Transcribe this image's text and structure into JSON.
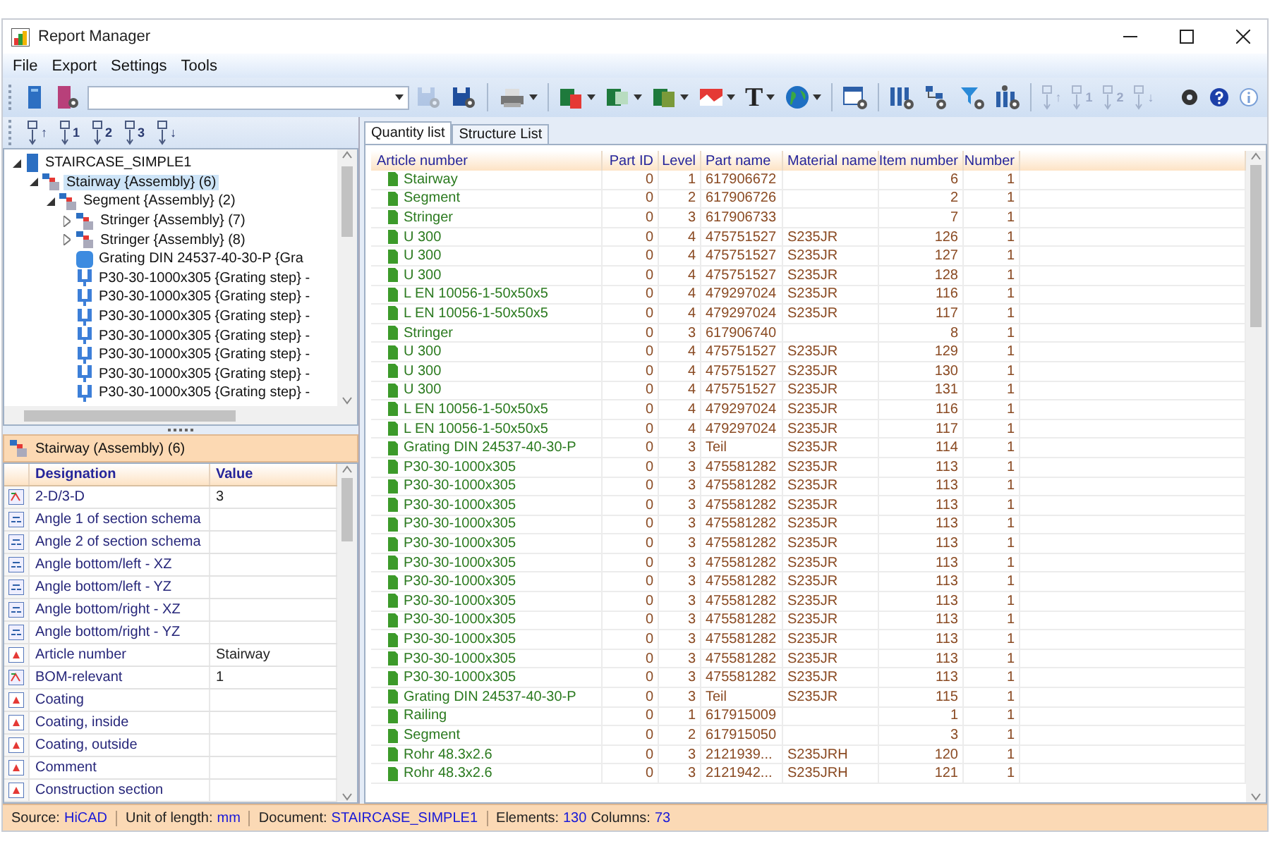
{
  "window": {
    "title": "Report Manager"
  },
  "menu": [
    "File",
    "Export",
    "Settings",
    "Tools"
  ],
  "toolbar": {
    "items": [
      {
        "kind": "book"
      },
      {
        "kind": "book-gear"
      },
      {
        "kind": "combo"
      },
      {
        "kind": "save",
        "disabled": true
      },
      {
        "kind": "save-gear",
        "disabled": false
      },
      {
        "kind": "separator"
      },
      {
        "kind": "printer",
        "dropdown": true
      },
      {
        "kind": "separator"
      },
      {
        "kind": "excel-pdf",
        "dropdown": true
      },
      {
        "kind": "excel",
        "dropdown": true
      },
      {
        "kind": "excel-doc",
        "dropdown": true
      },
      {
        "kind": "image",
        "dropdown": true
      },
      {
        "kind": "glyph",
        "glyph": "T",
        "dropdown": true
      },
      {
        "kind": "globe",
        "dropdown": true
      },
      {
        "kind": "separator"
      },
      {
        "kind": "table-gear"
      },
      {
        "kind": "separator"
      },
      {
        "kind": "columns-gear"
      },
      {
        "kind": "tree-gear"
      },
      {
        "kind": "filter-gear"
      },
      {
        "kind": "person-columns"
      },
      {
        "kind": "separator"
      },
      {
        "kind": "sort",
        "mark": "↑",
        "disabled": true
      },
      {
        "kind": "sort",
        "mark": "1",
        "disabled": true
      },
      {
        "kind": "sort",
        "mark": "2",
        "disabled": true
      },
      {
        "kind": "sort",
        "mark": "↓",
        "disabled": true
      },
      {
        "kind": "spacer"
      },
      {
        "kind": "gear"
      },
      {
        "kind": "help"
      },
      {
        "kind": "info"
      }
    ]
  },
  "sort_toolbar": [
    {
      "mark": "↑"
    },
    {
      "mark": "1"
    },
    {
      "mark": "2"
    },
    {
      "mark": "3"
    },
    {
      "mark": "↓"
    }
  ],
  "tree": [
    {
      "label": "STAIRCASE_SIMPLE1",
      "kind": "document",
      "expanded": true,
      "selected": false,
      "children": [
        {
          "label": "Stairway {Assembly} (6)",
          "kind": "assembly",
          "expanded": true,
          "selected": true,
          "children": [
            {
              "label": "Segment {Assembly} (2)",
              "kind": "assembly",
              "expanded": true,
              "selected": false,
              "children": [
                {
                  "label": "Stringer {Assembly} (7)",
                  "kind": "assembly",
                  "expanded": false,
                  "selected": false
                },
                {
                  "label": "Stringer {Assembly} (8)",
                  "kind": "assembly",
                  "expanded": false,
                  "selected": false
                },
                {
                  "label": "Grating DIN 24537-40-30-P {Gra",
                  "kind": "grating",
                  "selected": false
                },
                {
                  "label": "P30-30-1000x305 {Grating step} -",
                  "kind": "step",
                  "selected": false
                },
                {
                  "label": "P30-30-1000x305 {Grating step} -",
                  "kind": "step",
                  "selected": false
                },
                {
                  "label": "P30-30-1000x305 {Grating step} -",
                  "kind": "step",
                  "selected": false
                },
                {
                  "label": "P30-30-1000x305 {Grating step} -",
                  "kind": "step",
                  "selected": false
                },
                {
                  "label": "P30-30-1000x305 {Grating step} -",
                  "kind": "step",
                  "selected": false
                },
                {
                  "label": "P30-30-1000x305 {Grating step} -",
                  "kind": "step",
                  "selected": false
                },
                {
                  "label": "P30-30-1000x305 {Grating step} -",
                  "kind": "step",
                  "selected": false
                }
              ]
            }
          ]
        }
      ]
    }
  ],
  "properties": {
    "title": "Stairway (Assembly) (6)",
    "columns": [
      "Designation",
      "Value"
    ],
    "rows": [
      {
        "kind": "system",
        "designation": "2-D/3-D",
        "value": "3"
      },
      {
        "kind": "angle",
        "designation": "Angle 1 of section schema"
      },
      {
        "kind": "angle",
        "designation": "Angle 2 of section schema"
      },
      {
        "kind": "angle",
        "designation": "Angle bottom/left - XZ"
      },
      {
        "kind": "angle",
        "designation": "Angle bottom/left - YZ"
      },
      {
        "kind": "angle",
        "designation": "Angle bottom/right - XZ"
      },
      {
        "kind": "angle",
        "designation": "Angle bottom/right - YZ"
      },
      {
        "kind": "text",
        "designation": "Article number",
        "value": "Stairway"
      },
      {
        "kind": "system",
        "designation": "BOM-relevant",
        "value": "1"
      },
      {
        "kind": "text",
        "designation": "Coating"
      },
      {
        "kind": "text",
        "designation": "Coating, inside"
      },
      {
        "kind": "text",
        "designation": "Coating, outside"
      },
      {
        "kind": "text",
        "designation": "Comment"
      },
      {
        "kind": "text",
        "designation": "Construction section"
      }
    ]
  },
  "tabs": [
    {
      "label": "Quantity list",
      "selected": true
    },
    {
      "label": "Structure List",
      "selected": false
    }
  ],
  "table": {
    "columns": [
      "Article number",
      "Part ID",
      "Level",
      "Part name",
      "Material name",
      "Item number",
      "Number"
    ],
    "rows": [
      [
        "Stairway",
        "0",
        "1",
        "617906672",
        "",
        "6",
        "1"
      ],
      [
        "Segment",
        "0",
        "2",
        "617906726",
        "",
        "2",
        "1"
      ],
      [
        "Stringer",
        "0",
        "3",
        "617906733",
        "",
        "7",
        "1"
      ],
      [
        "U 300",
        "0",
        "4",
        "475751527",
        "S235JR",
        "126",
        "1"
      ],
      [
        "U 300",
        "0",
        "4",
        "475751527",
        "S235JR",
        "127",
        "1"
      ],
      [
        "U 300",
        "0",
        "4",
        "475751527",
        "S235JR",
        "128",
        "1"
      ],
      [
        "L EN 10056-1-50x50x5",
        "0",
        "4",
        "479297024",
        "S235JR",
        "116",
        "1"
      ],
      [
        "L EN 10056-1-50x50x5",
        "0",
        "4",
        "479297024",
        "S235JR",
        "117",
        "1"
      ],
      [
        "Stringer",
        "0",
        "3",
        "617906740",
        "",
        "8",
        "1"
      ],
      [
        "U 300",
        "0",
        "4",
        "475751527",
        "S235JR",
        "129",
        "1"
      ],
      [
        "U 300",
        "0",
        "4",
        "475751527",
        "S235JR",
        "130",
        "1"
      ],
      [
        "U 300",
        "0",
        "4",
        "475751527",
        "S235JR",
        "131",
        "1"
      ],
      [
        "L EN 10056-1-50x50x5",
        "0",
        "4",
        "479297024",
        "S235JR",
        "116",
        "1"
      ],
      [
        "L EN 10056-1-50x50x5",
        "0",
        "4",
        "479297024",
        "S235JR",
        "117",
        "1"
      ],
      [
        "Grating DIN 24537-40-30-P",
        "0",
        "3",
        "Teil",
        "S235JR",
        "114",
        "1"
      ],
      [
        "P30-30-1000x305",
        "0",
        "3",
        "475581282",
        "S235JR",
        "113",
        "1"
      ],
      [
        "P30-30-1000x305",
        "0",
        "3",
        "475581282",
        "S235JR",
        "113",
        "1"
      ],
      [
        "P30-30-1000x305",
        "0",
        "3",
        "475581282",
        "S235JR",
        "113",
        "1"
      ],
      [
        "P30-30-1000x305",
        "0",
        "3",
        "475581282",
        "S235JR",
        "113",
        "1"
      ],
      [
        "P30-30-1000x305",
        "0",
        "3",
        "475581282",
        "S235JR",
        "113",
        "1"
      ],
      [
        "P30-30-1000x305",
        "0",
        "3",
        "475581282",
        "S235JR",
        "113",
        "1"
      ],
      [
        "P30-30-1000x305",
        "0",
        "3",
        "475581282",
        "S235JR",
        "113",
        "1"
      ],
      [
        "P30-30-1000x305",
        "0",
        "3",
        "475581282",
        "S235JR",
        "113",
        "1"
      ],
      [
        "P30-30-1000x305",
        "0",
        "3",
        "475581282",
        "S235JR",
        "113",
        "1"
      ],
      [
        "P30-30-1000x305",
        "0",
        "3",
        "475581282",
        "S235JR",
        "113",
        "1"
      ],
      [
        "P30-30-1000x305",
        "0",
        "3",
        "475581282",
        "S235JR",
        "113",
        "1"
      ],
      [
        "P30-30-1000x305",
        "0",
        "3",
        "475581282",
        "S235JR",
        "113",
        "1"
      ],
      [
        "Grating DIN 24537-40-30-P",
        "0",
        "3",
        "Teil",
        "S235JR",
        "115",
        "1"
      ],
      [
        "Railing",
        "0",
        "1",
        "617915009",
        "",
        "1",
        "1"
      ],
      [
        "Segment",
        "0",
        "2",
        "617915050",
        "",
        "3",
        "1"
      ],
      [
        "Rohr 48.3x2.6",
        "0",
        "3",
        "2121939...",
        "S235JRH",
        "120",
        "1"
      ],
      [
        "Rohr 48.3x2.6",
        "0",
        "3",
        "2121942...",
        "S235JRH",
        "121",
        "1"
      ]
    ]
  },
  "status_bar": [
    [
      {
        "label": "Source:",
        "value": "HiCAD"
      }
    ],
    [
      {
        "label": "Unit of length:",
        "value": "mm"
      }
    ],
    [
      {
        "label": "Document:",
        "value": "STAIRCASE_SIMPLE1"
      }
    ],
    [
      {
        "label": "Elements:",
        "value": "130"
      },
      {
        "label": "Columns:",
        "value": "73"
      }
    ]
  ]
}
